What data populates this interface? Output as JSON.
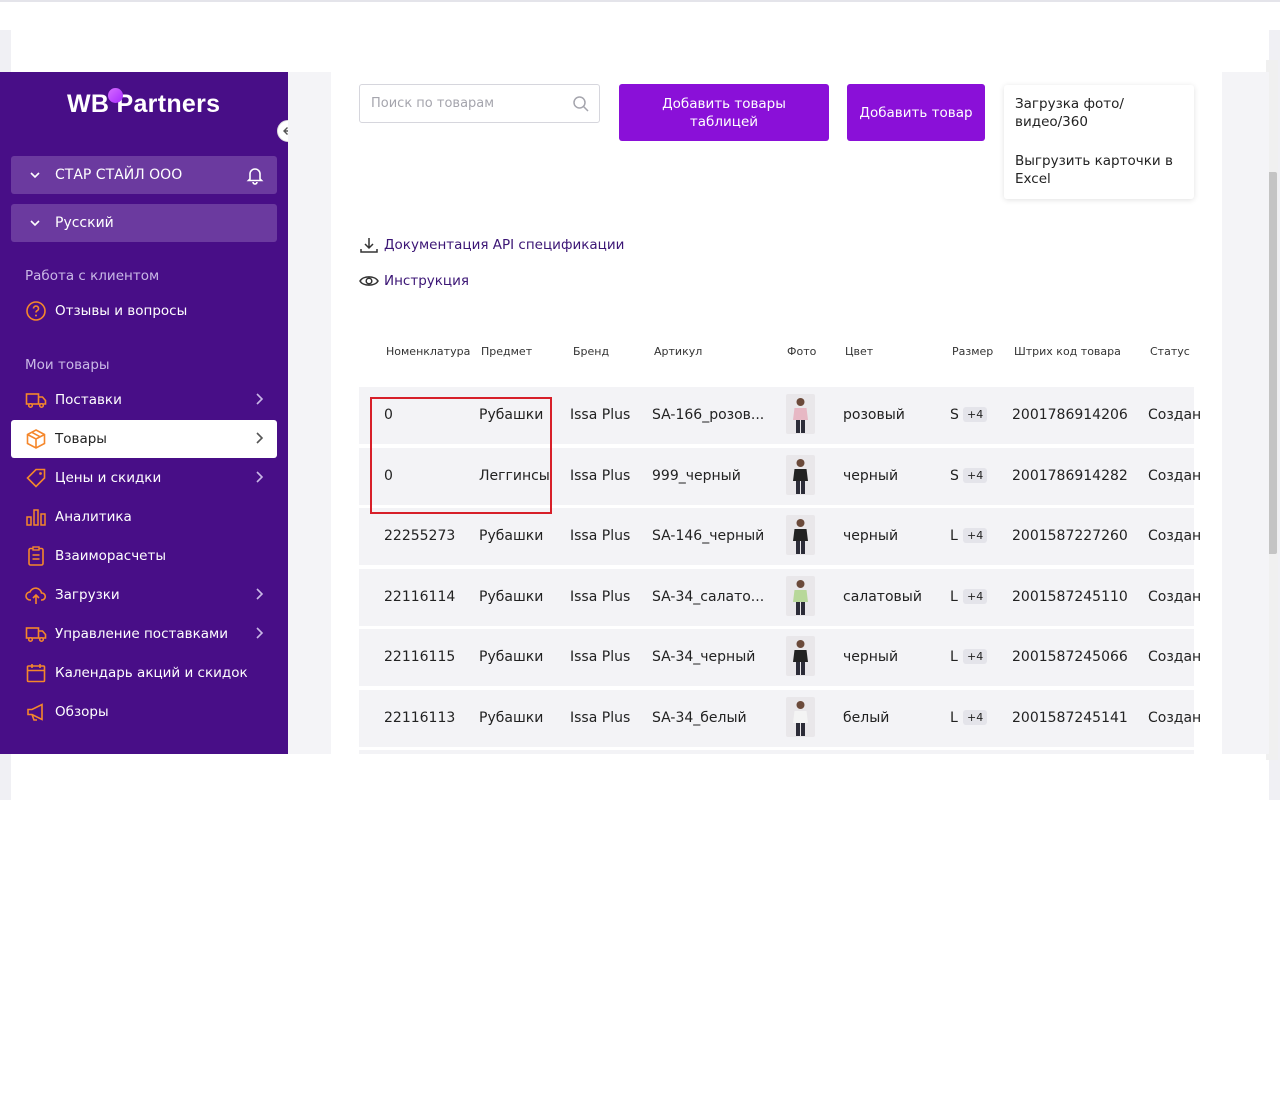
{
  "logo": {
    "text": "WB Partners",
    "dot_color": "#b354ff"
  },
  "sidebar": {
    "org_selector": {
      "label": "СТАР СТАЙЛ ООО"
    },
    "lang_selector": {
      "label": "Русский"
    },
    "sections": [
      {
        "title": "Работа с клиентом"
      },
      {
        "title": "Мои товары"
      }
    ],
    "items": [
      {
        "label": "Отзывы и вопросы",
        "icon": "question-icon"
      },
      {
        "label": "Поставки",
        "icon": "truck-icon"
      },
      {
        "label": "Товары",
        "icon": "box-icon",
        "active": true
      },
      {
        "label": "Цены и скидки",
        "icon": "tag-icon"
      },
      {
        "label": "Аналитика",
        "icon": "bar-chart-icon"
      },
      {
        "label": "Взаиморасчеты",
        "icon": "clipboard-icon"
      },
      {
        "label": "Загрузки",
        "icon": "cloud-upload-icon"
      },
      {
        "label": "Управление поставками",
        "icon": "truck-icon"
      },
      {
        "label": "Календарь акций и скидок",
        "icon": "calendar-icon"
      },
      {
        "label": "Обзоры",
        "icon": "megaphone-icon"
      }
    ]
  },
  "toolbar": {
    "search_placeholder": "Поиск по товарам",
    "btn_add_table": "Добавить товары таблицей",
    "btn_add_item": "Добавить товар",
    "menu": [
      "Загрузка фото/ видео/360",
      "Выгрузить карточки в Excel"
    ]
  },
  "links": {
    "api_doc": "Документация API спецификации",
    "instruction": "Инструкция"
  },
  "table": {
    "columns": [
      "Номенклатура",
      "Предмет",
      "Бренд",
      "Артикул",
      "Фото",
      "Цвет",
      "Размер",
      "Штрих код товара",
      "Статус"
    ],
    "rows": [
      {
        "nm": "0",
        "subject": "Рубашки",
        "brand": "Issa Plus",
        "article": "SA-166_розов...",
        "color": "розовый",
        "size": "S",
        "more": "+4",
        "barcode": "2001786914206",
        "status": "Создан"
      },
      {
        "nm": "0",
        "subject": "Леггинсы",
        "brand": "Issa Plus",
        "article": "999_черный",
        "color": "черный",
        "size": "S",
        "more": "+4",
        "barcode": "2001786914282",
        "status": "Создан"
      },
      {
        "nm": "22255273",
        "subject": "Рубашки",
        "brand": "Issa Plus",
        "article": "SA-146_черный",
        "color": "черный",
        "size": "L",
        "more": "+4",
        "barcode": "2001587227260",
        "status": "Создан"
      },
      {
        "nm": "22116114",
        "subject": "Рубашки",
        "brand": "Issa Plus",
        "article": "SA-34_салато...",
        "color": "салатовый",
        "size": "L",
        "more": "+4",
        "barcode": "2001587245110",
        "status": "Создан"
      },
      {
        "nm": "22116115",
        "subject": "Рубашки",
        "brand": "Issa Plus",
        "article": "SA-34_черный",
        "color": "черный",
        "size": "L",
        "more": "+4",
        "barcode": "2001587245066",
        "status": "Создан"
      },
      {
        "nm": "22116113",
        "subject": "Рубашки",
        "brand": "Issa Plus",
        "article": "SA-34_белый",
        "color": "белый",
        "size": "L",
        "more": "+4",
        "barcode": "2001587245141",
        "status": "Создан"
      }
    ]
  },
  "colors": {
    "sidebar": "#480e87",
    "accent": "#8a10d8",
    "highlight": "#d71f29"
  }
}
